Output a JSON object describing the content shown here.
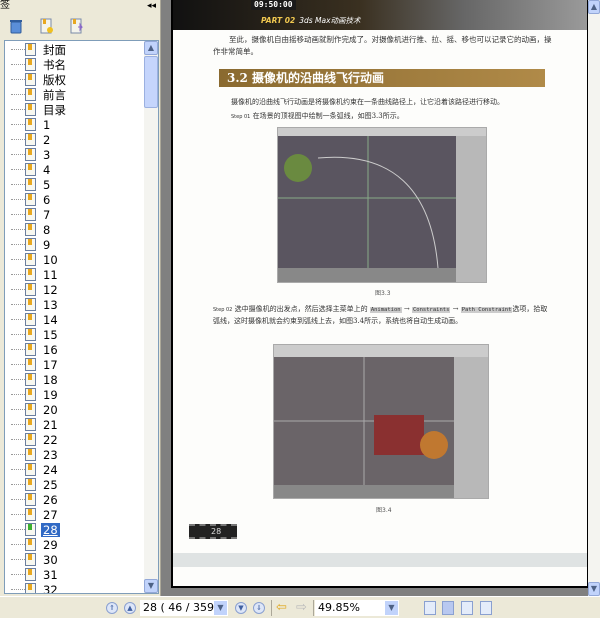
{
  "sidebar": {
    "title": "签",
    "collapse_icon": "◂◂",
    "items": [
      "封面",
      "书名",
      "版权",
      "前言",
      "目录",
      "1",
      "2",
      "3",
      "4",
      "5",
      "6",
      "7",
      "8",
      "9",
      "10",
      "11",
      "12",
      "13",
      "14",
      "15",
      "16",
      "17",
      "18",
      "19",
      "20",
      "21",
      "22",
      "23",
      "24",
      "25",
      "26",
      "27",
      "28",
      "29",
      "30",
      "31",
      "32"
    ],
    "selected": "28"
  },
  "page": {
    "banner_part": "PART 02",
    "banner_title": "3ds Max动画技术",
    "banner_time": "09:50:00",
    "para1": "至此，摄像机自由摇移动画就制作完成了。对摄像机进行推、拉、摇、移也可以记录它的动画，操作非常简单。",
    "heading": "3.2   摄像机的沿曲线飞行动画",
    "para2": "摄像机的沿曲线飞行动画是将摄像机约束在一条曲线路径上，让它沿着该路径进行移动。",
    "step1_label": "Step 01",
    "step1_text": "在场景的顶视图中绘制一条弧线，如图3.3所示。",
    "fig1_caption": "图3.3",
    "step2_label": "Step 02",
    "step2_text_a": "选中摄像机的出发点，然后选择主菜单上的",
    "kw1": "Animation",
    "kw2": "Constraints",
    "kw3": "Path Constraint",
    "step2_text_b": "选项，拾取弧线，这时摄像机就会约束到弧线上去，如图3.4所示，系统也将自动生成动画。",
    "fig2_caption": "图3.4",
    "page_number": "28"
  },
  "bottom": {
    "page_value": "28  ( 46 / 359 )",
    "zoom_value": "49.85%"
  }
}
